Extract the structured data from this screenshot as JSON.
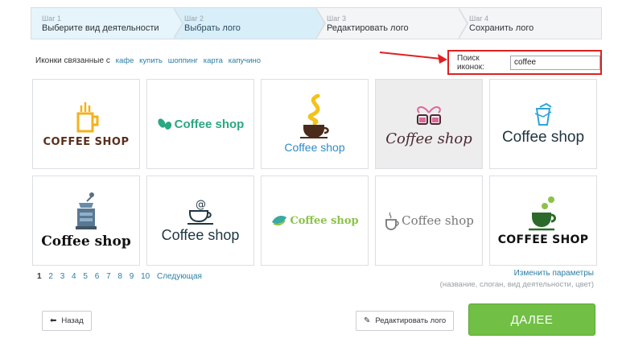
{
  "steps": [
    {
      "num": "Шаг 1",
      "title": "Выберите вид деятельности",
      "state": "done"
    },
    {
      "num": "Шаг 2",
      "title": "Выбрать лого",
      "state": "active"
    },
    {
      "num": "Шаг 3",
      "title": "Редактировать лого",
      "state": "todo"
    },
    {
      "num": "Шаг 4",
      "title": "Сохранить лого",
      "state": "todo"
    }
  ],
  "related": {
    "label": "Иконки связанные с",
    "links": [
      "кафе",
      "купить",
      "шоппинг",
      "карта",
      "капучино"
    ]
  },
  "search": {
    "label": "Поиск иконок:",
    "value": "coffee"
  },
  "logos": [
    {
      "text": "COFFEE SHOP",
      "icon": "coffee-tower-icon",
      "color": "#5a2e1c"
    },
    {
      "text": "Coffee shop",
      "icon": "coffee-beans-icon",
      "color": "#2aa783"
    },
    {
      "text": "Coffee shop",
      "icon": "steaming-cup-icon",
      "color": "#2f8bc4"
    },
    {
      "text": "Coffee shop",
      "icon": "heart-cups-icon",
      "color": "#4a2b30"
    },
    {
      "text": "Coffee shop",
      "icon": "paper-cup-icon",
      "color": "#1e3540"
    },
    {
      "text": "Coffee shop",
      "icon": "coffee-grinder-icon",
      "color": "#111111"
    },
    {
      "text": "Coffee shop",
      "icon": "cup-at-icon",
      "color": "#1e3540"
    },
    {
      "text": "Coffee shop",
      "icon": "coffee-leaf-icon",
      "color": "#8bc34a"
    },
    {
      "text": "Coffee shop",
      "icon": "tea-kettle-icon",
      "color": "#777777"
    },
    {
      "text": "COFFEE SHOP",
      "icon": "green-cup-icon",
      "color": "#111111"
    }
  ],
  "pager": {
    "pages": [
      "1",
      "2",
      "3",
      "4",
      "5",
      "6",
      "7",
      "8",
      "9",
      "10"
    ],
    "next": "Следующая"
  },
  "params": {
    "link": "Изменить параметры",
    "hint": "(название, слоган, вид деятельности, цвет)"
  },
  "buttons": {
    "back": "Назад",
    "edit": "Редактировать лого",
    "next": "ДАЛЕЕ"
  },
  "colors": {
    "accent": "#71bf44",
    "link": "#2a7fa5",
    "annotation": "#e02020"
  }
}
